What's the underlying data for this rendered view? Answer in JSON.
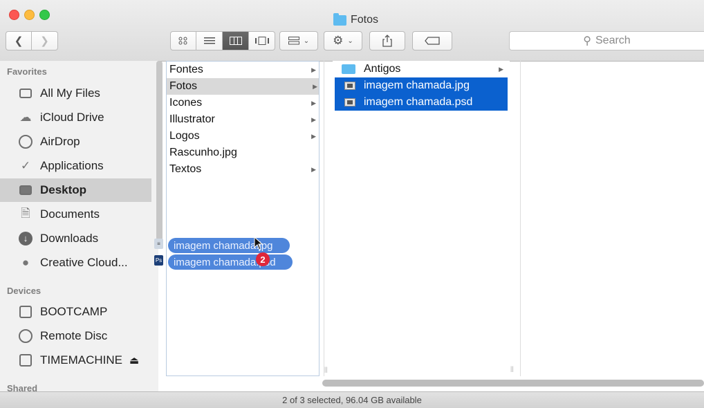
{
  "window": {
    "title": "Fotos"
  },
  "toolbar": {
    "back_icon": "chevron-left-icon",
    "forward_icon": "chevron-right-icon",
    "view_modes": [
      "icon-view",
      "list-view",
      "column-view",
      "cover-flow-view"
    ],
    "active_view": "column-view",
    "search_placeholder": "Search"
  },
  "sidebar": {
    "favorites_heading": "Favorites",
    "favorites": [
      {
        "label": "All My Files",
        "icon": "all-files-icon"
      },
      {
        "label": "iCloud Drive",
        "icon": "cloud-icon"
      },
      {
        "label": "AirDrop",
        "icon": "airdrop-icon"
      },
      {
        "label": "Applications",
        "icon": "applications-icon"
      },
      {
        "label": "Desktop",
        "icon": "desktop-icon",
        "selected": true
      },
      {
        "label": "Documents",
        "icon": "documents-icon"
      },
      {
        "label": "Downloads",
        "icon": "downloads-icon"
      },
      {
        "label": "Creative Cloud...",
        "icon": "creative-cloud-icon"
      }
    ],
    "devices_heading": "Devices",
    "devices": [
      {
        "label": "BOOTCAMP",
        "icon": "drive-icon"
      },
      {
        "label": "Remote Disc",
        "icon": "disc-icon"
      },
      {
        "label": "TIMEMACHINE",
        "icon": "drive-icon",
        "eject": "⏏"
      }
    ],
    "shared_heading": "Shared"
  },
  "column1": [
    {
      "label": "Fontes",
      "has_children": true
    },
    {
      "label": "Fotos",
      "has_children": true,
      "highlighted": true
    },
    {
      "label": "Icones",
      "has_children": true
    },
    {
      "label": "Illustrator",
      "has_children": true
    },
    {
      "label": "Logos",
      "has_children": true
    },
    {
      "label": "Rascunho.jpg",
      "has_children": false
    },
    {
      "label": "Textos",
      "has_children": true
    }
  ],
  "column2": [
    {
      "label": "Antigos",
      "type": "folder",
      "has_children": true
    },
    {
      "label": "imagem chamada.jpg",
      "type": "image",
      "selected": true
    },
    {
      "label": "imagem chamada.psd",
      "type": "image",
      "selected": true
    }
  ],
  "drag": {
    "items": [
      "imagem chamada.jpg",
      "imagem chamada.psd"
    ],
    "count": "2"
  },
  "status": {
    "text": "2 of 3 selected, 96.04 GB available"
  },
  "colors": {
    "selection": "#0b61cf",
    "badge": "#e0263a",
    "folder": "#5ebbf0"
  }
}
